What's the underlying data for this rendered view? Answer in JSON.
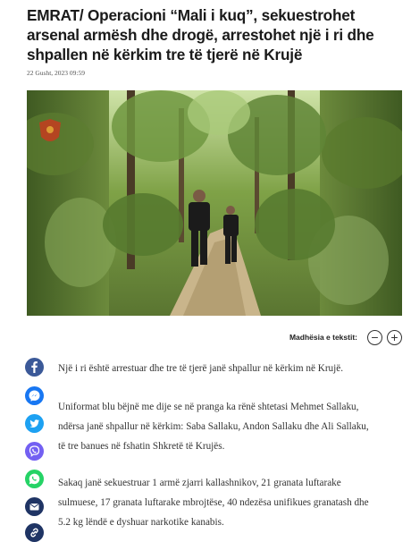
{
  "article": {
    "headline": "EMRAT/ Operacioni “Mali i kuq”, sekuestrohet arsenal armësh dhe drogë, arrestohet një i ri dhe shpallen në kërkim tre të tjerë në Krujë",
    "date": "22 Gusht, 2023 09:59",
    "paragraphs": [
      "Një i ri është arrestuar dhe tre të tjerë janë shpallur në kërkim në Krujë.",
      "Uniformat blu bëjnë me dije se në pranga ka rënë shtetasi Mehmet Sallaku, ndërsa janë shpallur në kërkim: Saba Sallaku, Andon Sallaku dhe Ali Sallaku, të tre banues në fshatin Shkretë të Krujës.",
      "Sakaq janë sekuestruar 1 armë zjarri kallashnikov, 21 granata luftarake sulmuese, 17 granata luftarake mbrojtëse, 40 ndezësa unifikues granatash dhe 5.2 kg lëndë e dyshuar narkotike kanabis."
    ]
  },
  "text_size": {
    "label": "Madhësia e tekstit:",
    "decrease_symbol": "−",
    "increase_symbol": "+"
  },
  "share": [
    {
      "name": "facebook",
      "icon": "facebook-icon",
      "color": "#3b5998"
    },
    {
      "name": "messenger",
      "icon": "messenger-icon",
      "color": "#1877f2"
    },
    {
      "name": "twitter",
      "icon": "twitter-icon",
      "color": "#1da1f2"
    },
    {
      "name": "viber",
      "icon": "viber-icon",
      "color": "#7360f2"
    },
    {
      "name": "whatsapp",
      "icon": "whatsapp-icon",
      "color": "#25d366"
    },
    {
      "name": "email",
      "icon": "email-icon",
      "color": "#1f3464"
    },
    {
      "name": "link",
      "icon": "link-icon",
      "color": "#1f3464"
    }
  ]
}
